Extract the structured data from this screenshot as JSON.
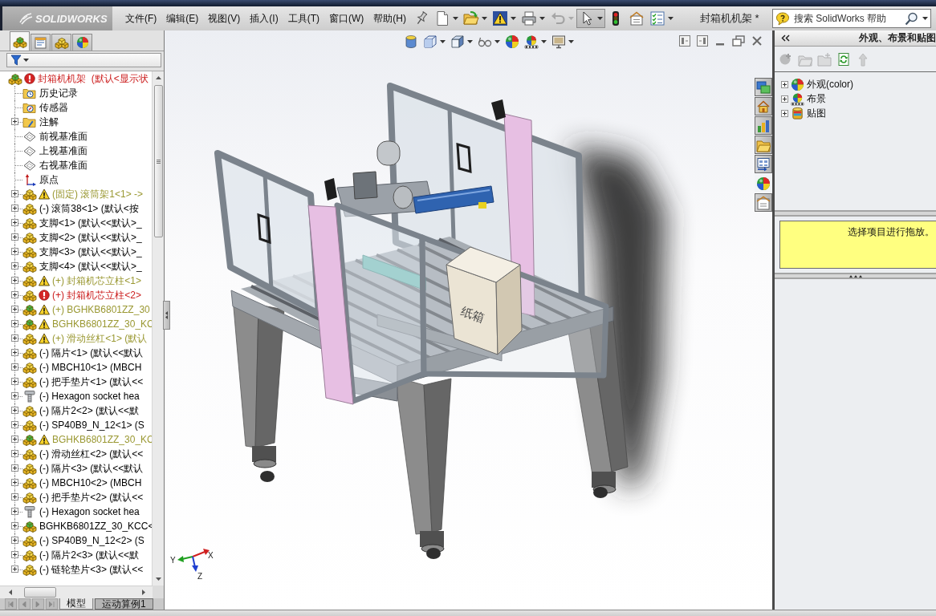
{
  "app": {
    "logo": "SOLIDWORKS",
    "menus": [
      "文件(F)",
      "编辑(E)",
      "视图(V)",
      "插入(I)",
      "工具(T)",
      "窗口(W)",
      "帮助(H)"
    ],
    "toolbar": [
      {
        "kind": "new",
        "dropdown": true,
        "disabled": false,
        "selected": false
      },
      {
        "kind": "open",
        "dropdown": true,
        "disabled": false,
        "selected": false
      },
      {
        "kind": "rebuild",
        "dropdown": true,
        "disabled": false,
        "selected": false
      },
      {
        "kind": "print",
        "dropdown": true,
        "disabled": false,
        "selected": false
      },
      {
        "kind": "undo",
        "dropdown": true,
        "disabled": true,
        "selected": false
      },
      {
        "kind": "select",
        "dropdown": true,
        "disabled": false,
        "selected": true
      },
      {
        "kind": "rebuild_status",
        "dropdown": false,
        "disabled": false,
        "selected": false
      },
      {
        "kind": "options",
        "dropdown": false,
        "disabled": false,
        "selected": false
      },
      {
        "kind": "file_properties",
        "dropdown": true,
        "disabled": false,
        "selected": false
      }
    ],
    "document_title": "封箱机机架 *",
    "search": {
      "placeholder": "搜索 SolidWorks 帮助"
    }
  },
  "feature_panel": {
    "tabs": [
      {
        "kind": "feature_tree",
        "selected": true
      },
      {
        "kind": "properties",
        "selected": false
      },
      {
        "kind": "configurations",
        "selected": false
      },
      {
        "kind": "display",
        "selected": false
      }
    ],
    "tree": {
      "label": "封箱机机架  (默认<显示状",
      "kind": "subassembly",
      "warning": false,
      "error": true,
      "children": [
        {
          "label": "历史记录",
          "kind": "history",
          "warning": false,
          "error": false
        },
        {
          "label": "传感器",
          "kind": "sensors",
          "warning": false,
          "error": false
        },
        {
          "label": "注解",
          "kind": "annotations",
          "warning": false,
          "error": false,
          "expanded": false
        },
        {
          "label": "前视基准面",
          "kind": "plane",
          "warning": false,
          "error": false
        },
        {
          "label": "上视基准面",
          "kind": "plane",
          "warning": false,
          "error": false
        },
        {
          "label": "右视基准面",
          "kind": "plane",
          "warning": false,
          "error": false
        },
        {
          "label": "原点",
          "kind": "origin",
          "warning": false,
          "error": false
        },
        {
          "label": "(固定) 滚筒架1<1> ->",
          "kind": "component",
          "warning": true,
          "error": false,
          "expanded": false
        },
        {
          "label": "(-) 滚筒38<1> (默认<按",
          "kind": "component",
          "warning": false,
          "error": false,
          "expanded": false
        },
        {
          "label": "支脚<1> (默认<<默认>_",
          "kind": "component",
          "warning": false,
          "error": false,
          "expanded": false
        },
        {
          "label": "支脚<2> (默认<<默认>_",
          "kind": "component",
          "warning": false,
          "error": false,
          "expanded": false
        },
        {
          "label": "支脚<3> (默认<<默认>_",
          "kind": "component",
          "warning": false,
          "error": false,
          "expanded": false
        },
        {
          "label": "支脚<4> (默认<<默认>_",
          "kind": "component",
          "warning": false,
          "error": false,
          "expanded": false
        },
        {
          "label": "(+) 封箱机芯立柱<1>",
          "kind": "component",
          "warning": true,
          "error": false,
          "expanded": false
        },
        {
          "label": "(+) 封箱机芯立柱<2>",
          "kind": "component",
          "warning": false,
          "error": true,
          "expanded": false
        },
        {
          "label": "(+) BGHKB6801ZZ_30",
          "kind": "subassembly",
          "warning": true,
          "error": false,
          "expanded": false
        },
        {
          "label": "BGHKB6801ZZ_30_KC",
          "kind": "subassembly",
          "warning": true,
          "error": false,
          "expanded": false
        },
        {
          "label": "(+) 滑动丝杠<1> (默认",
          "kind": "component",
          "warning": true,
          "error": false,
          "expanded": false
        },
        {
          "label": "(-) 隔片<1> (默认<<默认",
          "kind": "component",
          "warning": false,
          "error": false,
          "expanded": false
        },
        {
          "label": "(-) MBCH10<1> (MBCH",
          "kind": "component",
          "warning": false,
          "error": false,
          "expanded": false
        },
        {
          "label": "(-) 把手垫片<1> (默认<<",
          "kind": "component",
          "warning": false,
          "error": false,
          "expanded": false
        },
        {
          "label": "(-) Hexagon socket hea",
          "kind": "fastener",
          "warning": false,
          "error": false,
          "expanded": false
        },
        {
          "label": "(-) 隔片2<2> (默认<<默",
          "kind": "component",
          "warning": false,
          "error": false,
          "expanded": false
        },
        {
          "label": "(-) SP40B9_N_12<1> (S",
          "kind": "component",
          "warning": false,
          "error": false,
          "expanded": false
        },
        {
          "label": "BGHKB6801ZZ_30_KC",
          "kind": "subassembly",
          "warning": true,
          "error": false,
          "expanded": false
        },
        {
          "label": "(-) 滑动丝杠<2> (默认<<",
          "kind": "component",
          "warning": false,
          "error": false,
          "expanded": false
        },
        {
          "label": "(-) 隔片<3> (默认<<默认",
          "kind": "component",
          "warning": false,
          "error": false,
          "expanded": false
        },
        {
          "label": "(-) MBCH10<2> (MBCH",
          "kind": "component",
          "warning": false,
          "error": false,
          "expanded": false
        },
        {
          "label": "(-) 把手垫片<2> (默认<<",
          "kind": "component",
          "warning": false,
          "error": false,
          "expanded": false
        },
        {
          "label": "(-) Hexagon socket hea",
          "kind": "fastener",
          "warning": false,
          "error": false,
          "expanded": false
        },
        {
          "label": "BGHKB6801ZZ_30_KCC<",
          "kind": "subassembly",
          "warning": false,
          "error": false,
          "expanded": false
        },
        {
          "label": "(-) SP40B9_N_12<2> (S",
          "kind": "component",
          "warning": false,
          "error": false,
          "expanded": false
        },
        {
          "label": "(-) 隔片2<3> (默认<<默",
          "kind": "component",
          "warning": false,
          "error": false,
          "expanded": false
        },
        {
          "label": "(-) 链轮垫片<3> (默认<<",
          "kind": "component",
          "warning": false,
          "error": false,
          "expanded": false
        }
      ]
    },
    "bottom_tabs": [
      {
        "label": "模型",
        "selected": true
      },
      {
        "label": "运动算例1",
        "selected": false
      }
    ]
  },
  "graphics_area": {
    "view_toolbar": [
      {
        "kind": "section",
        "dropdown": false
      },
      {
        "kind": "orientation",
        "dropdown": true
      },
      {
        "kind": "display_style",
        "dropdown": true
      },
      {
        "kind": "hide_show",
        "dropdown": true
      },
      {
        "kind": "appearance",
        "dropdown": false
      },
      {
        "kind": "scene",
        "dropdown": true
      },
      {
        "kind": "view_settings",
        "dropdown": true
      }
    ],
    "carton_label": "纸箱",
    "triad": {
      "x": "X",
      "y": "Y",
      "z": "Z"
    }
  },
  "task_pane": {
    "tabs": [
      {
        "kind": "screens",
        "selected": false
      },
      {
        "kind": "home",
        "selected": false
      },
      {
        "kind": "design_library",
        "selected": false
      },
      {
        "kind": "file_explorer",
        "selected": false
      },
      {
        "kind": "view_palette",
        "selected": false
      },
      {
        "kind": "appearances",
        "selected": true
      },
      {
        "kind": "custom_properties",
        "selected": false
      }
    ],
    "title": "外观、布景和贴图",
    "toolbar": [
      {
        "kind": "add",
        "disabled": true
      },
      {
        "kind": "open_folder",
        "disabled": true
      },
      {
        "kind": "new_folder",
        "disabled": true
      },
      {
        "kind": "refresh",
        "disabled": false
      },
      {
        "kind": "up",
        "disabled": true
      }
    ],
    "tree": [
      {
        "label": "外观(color)",
        "kind": "appearance",
        "expanded": false
      },
      {
        "label": "布景",
        "kind": "scene",
        "expanded": false
      },
      {
        "label": "贴图",
        "kind": "decal",
        "expanded": false
      }
    ],
    "hint": "选择项目进行拖放。"
  }
}
